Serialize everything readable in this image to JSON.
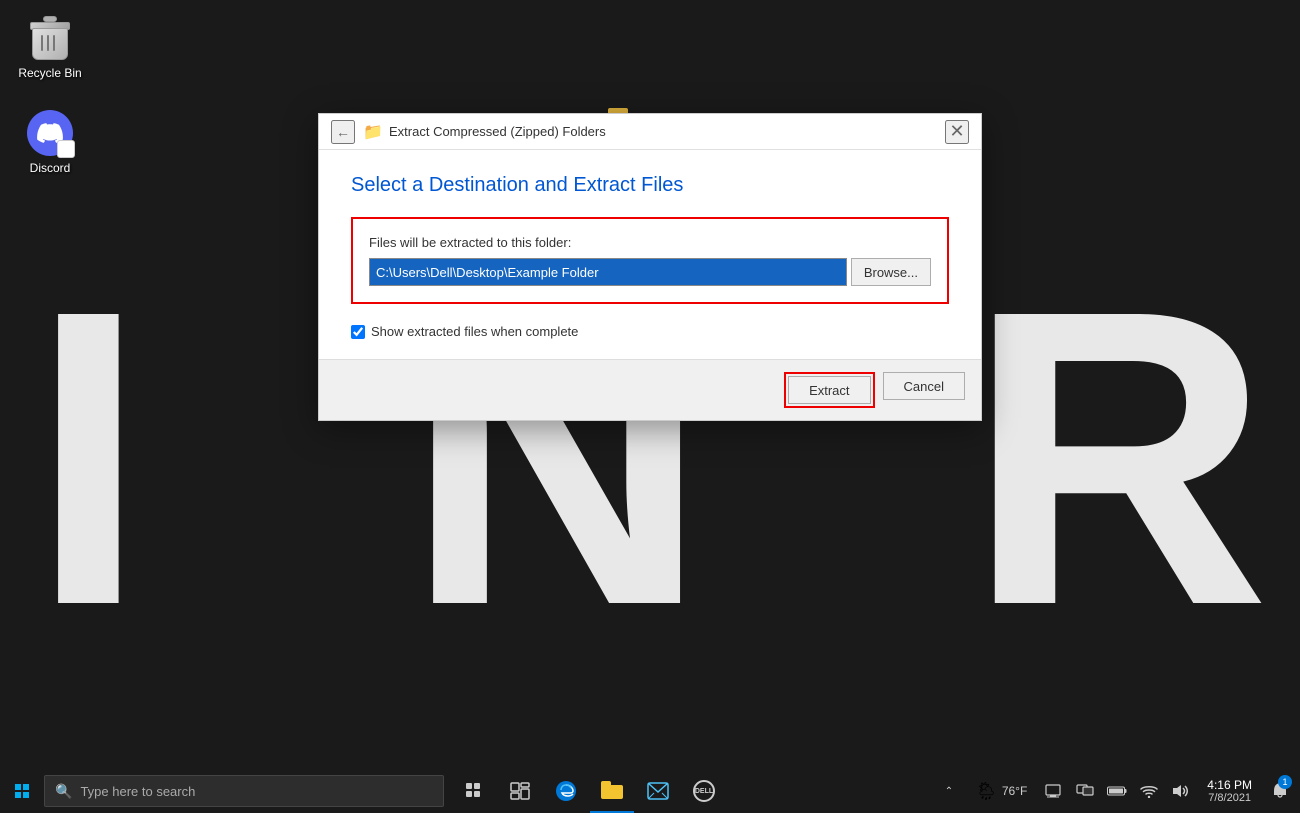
{
  "desktop": {
    "icons": [
      {
        "id": "recycle-bin",
        "label": "Recycle Bin",
        "type": "recycle"
      },
      {
        "id": "discord",
        "label": "Discord",
        "type": "discord"
      }
    ],
    "bg_letters": [
      "I",
      "N",
      "R"
    ]
  },
  "dialog": {
    "title": "Extract Compressed (Zipped) Folders",
    "heading": "Select a Destination and Extract Files",
    "destination_label": "Files will be extracted to this folder:",
    "destination_path": "C:\\Users\\Dell\\Desktop\\Example Folder",
    "browse_label": "Browse...",
    "checkbox_label": "Show extracted files when complete",
    "checkbox_checked": true,
    "extract_label": "Extract",
    "cancel_label": "Cancel"
  },
  "taskbar": {
    "search_placeholder": "Type here to search",
    "weather": "76°F",
    "weather_icon": "🌦",
    "time": "4:16 PM",
    "date": "7/8/2021",
    "notification_count": "1"
  }
}
